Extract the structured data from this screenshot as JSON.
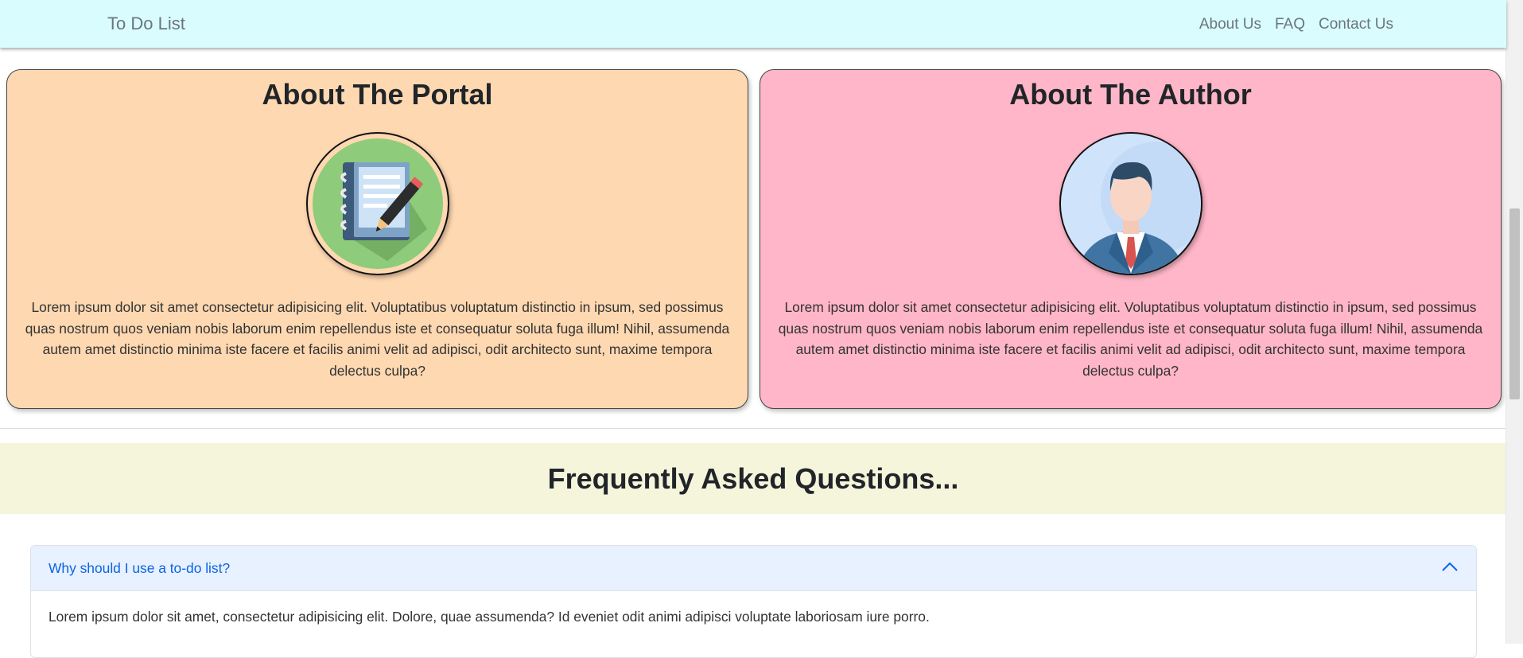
{
  "navbar": {
    "brand": "To Do List",
    "links": [
      "About Us",
      "FAQ",
      "Contact Us"
    ]
  },
  "cards": {
    "portal": {
      "title": "About The Portal",
      "icon": "notebook-pencil-icon",
      "text": "Lorem ipsum dolor sit amet consectetur adipisicing elit. Voluptatibus voluptatum distinctio in ipsum, sed possimus quas nostrum quos veniam nobis laborum enim repellendus iste et consequatur soluta fuga illum! Nihil, assumenda autem amet distinctio minima iste facere et facilis animi velit ad adipisci, odit architecto sunt, maxime tempora delectus culpa?"
    },
    "author": {
      "title": "About The Author",
      "icon": "businessman-avatar-icon",
      "text": "Lorem ipsum dolor sit amet consectetur adipisicing elit. Voluptatibus voluptatum distinctio in ipsum, sed possimus quas nostrum quos veniam nobis laborum enim repellendus iste et consequatur soluta fuga illum! Nihil, assumenda autem amet distinctio minima iste facere et facilis animi velit ad adipisci, odit architecto sunt, maxime tempora delectus culpa?"
    }
  },
  "faq": {
    "heading": "Frequently Asked Questions...",
    "items": [
      {
        "question": "Why should I use a to-do list?",
        "answer": "Lorem ipsum dolor sit amet, consectetur adipisicing elit. Dolore, quae assumenda? Id eveniet odit animi adipisci voluptate laboriosam iure porro.",
        "expanded": true
      }
    ]
  },
  "colors": {
    "navbar_bg": "#d9fcff",
    "portal_card_bg": "#fed8b1",
    "author_card_bg": "#ffb6c8",
    "faq_banner_bg": "#f5f5dc",
    "accordion_active_bg": "#e7f1ff",
    "accordion_active_text": "#0c63e4"
  }
}
